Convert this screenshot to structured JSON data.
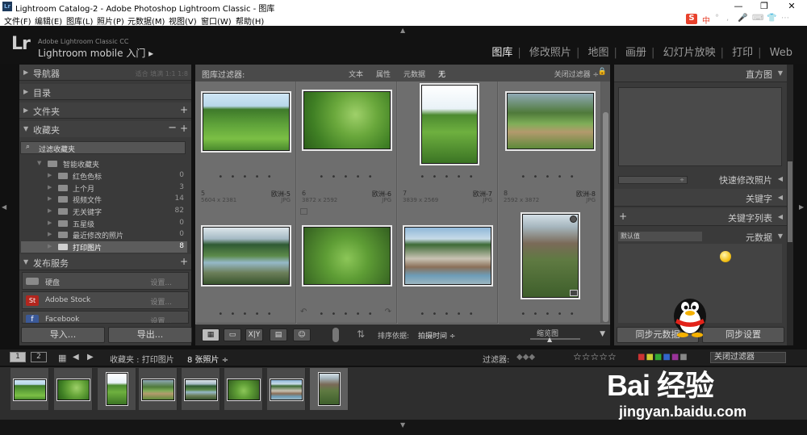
{
  "titlebar": {
    "title": "Lightroom Catalog-2 - Adobe Photoshop Lightroom Classic - 图库",
    "app_icon": "Lr",
    "minimize": "—",
    "restore": "❐",
    "close": "✕"
  },
  "menubar": [
    "文件(F)",
    "编辑(E)",
    "图库(L)",
    "照片(P)",
    "元数据(M)",
    "视图(V)",
    "窗口(W)",
    "帮助(H)"
  ],
  "ime": {
    "brand": "S",
    "items": [
      "中",
      "°",
      ",",
      "🎤",
      "⌨",
      "👕",
      "⋯"
    ]
  },
  "identity": {
    "logo": "Lr",
    "line1": "Adobe Lightroom Classic CC",
    "line2": "Lightroom mobile 入门 ▸"
  },
  "modules": [
    "图库",
    "修改照片",
    "地图",
    "画册",
    "幻灯片放映",
    "打印",
    "Web"
  ],
  "left_panel": {
    "navigator": {
      "label": "导航器",
      "zoom": "适合  填满  1:1  1:8"
    },
    "catalog": "目录",
    "folders": "文件夹",
    "collections": "收藏夹",
    "filter_placeholder": "过滤收藏夹",
    "smart_collections_label": "智能收藏夹",
    "collection_items": [
      {
        "name": "红色色标",
        "count": "0"
      },
      {
        "name": "上个月",
        "count": "3"
      },
      {
        "name": "视频文件",
        "count": "14"
      },
      {
        "name": "无关键字",
        "count": "82"
      },
      {
        "name": "五星级",
        "count": "0"
      },
      {
        "name": "最近修改的照片",
        "count": "0"
      },
      {
        "name": "打印图片",
        "count": "8"
      }
    ],
    "publish_label": "发布服务",
    "publish_items": [
      {
        "name": "硬盘",
        "action": "设置..."
      },
      {
        "name": "Adobe Stock",
        "action": "设置..."
      },
      {
        "name": "Facebook",
        "action": "设置..."
      }
    ],
    "import_btn": "导入...",
    "export_btn": "导出..."
  },
  "filter_bar": {
    "label": "图库过滤器:",
    "options": [
      "文本",
      "属性",
      "元数据",
      "无"
    ],
    "close": "关闭过滤器 ÷",
    "lock": "🔒"
  },
  "grid": [
    {
      "num": "",
      "dim": "",
      "name": "",
      "type": "",
      "dots": "• • • • •"
    },
    {
      "num": "",
      "dim": "",
      "name": "",
      "type": "",
      "dots": "• • • • •"
    },
    {
      "num": "",
      "dim": "",
      "name": "",
      "type": "",
      "dots": "• • • • •"
    },
    {
      "num": "",
      "dim": "",
      "name": "",
      "type": "",
      "dots": "• • • • •"
    },
    {
      "num": "5",
      "dim": "5604 x 2381",
      "name": "欧洲-5",
      "type": "JPG",
      "dots": "• • • • •"
    },
    {
      "num": "6",
      "dim": "3872 x 2592",
      "name": "欧洲-6",
      "type": "JPG",
      "dots": "• • • • •"
    },
    {
      "num": "7",
      "dim": "3839 x 2569",
      "name": "欧洲-7",
      "type": "JPG",
      "dots": "• • • • •"
    },
    {
      "num": "8",
      "dim": "2592 x 3872",
      "name": "欧洲-8",
      "type": "JPG",
      "dots": "• • • • •"
    }
  ],
  "toolbar": {
    "sort_label": "排序依据:",
    "sort_value": "拍摄时间 ÷",
    "thumb_label": "缩览图",
    "dropdown": "▼",
    "views": [
      "▦",
      "▭",
      "X|Y",
      "▤",
      "☺"
    ]
  },
  "right_panel": {
    "histogram": "直方图",
    "quick_develop": "快速修改照片",
    "keywording": "关键字",
    "keyword_list": "关键字列表",
    "keyword_plus": "+",
    "metadata": "元数据",
    "metadata_preset": "默认值",
    "sync_meta": "同步元数据",
    "sync_settings": "同步设置"
  },
  "filmbar": {
    "pages": [
      "1",
      "2"
    ],
    "source": "收藏夹 : 打印图片",
    "count": "8 张照片 ÷",
    "filter_label": "过滤器:",
    "stars": "☆☆☆☆☆",
    "filter_off": "关闭过滤器"
  },
  "watermark": {
    "logo": "Bai 经验",
    "url": "jingyan.baidu.com"
  }
}
